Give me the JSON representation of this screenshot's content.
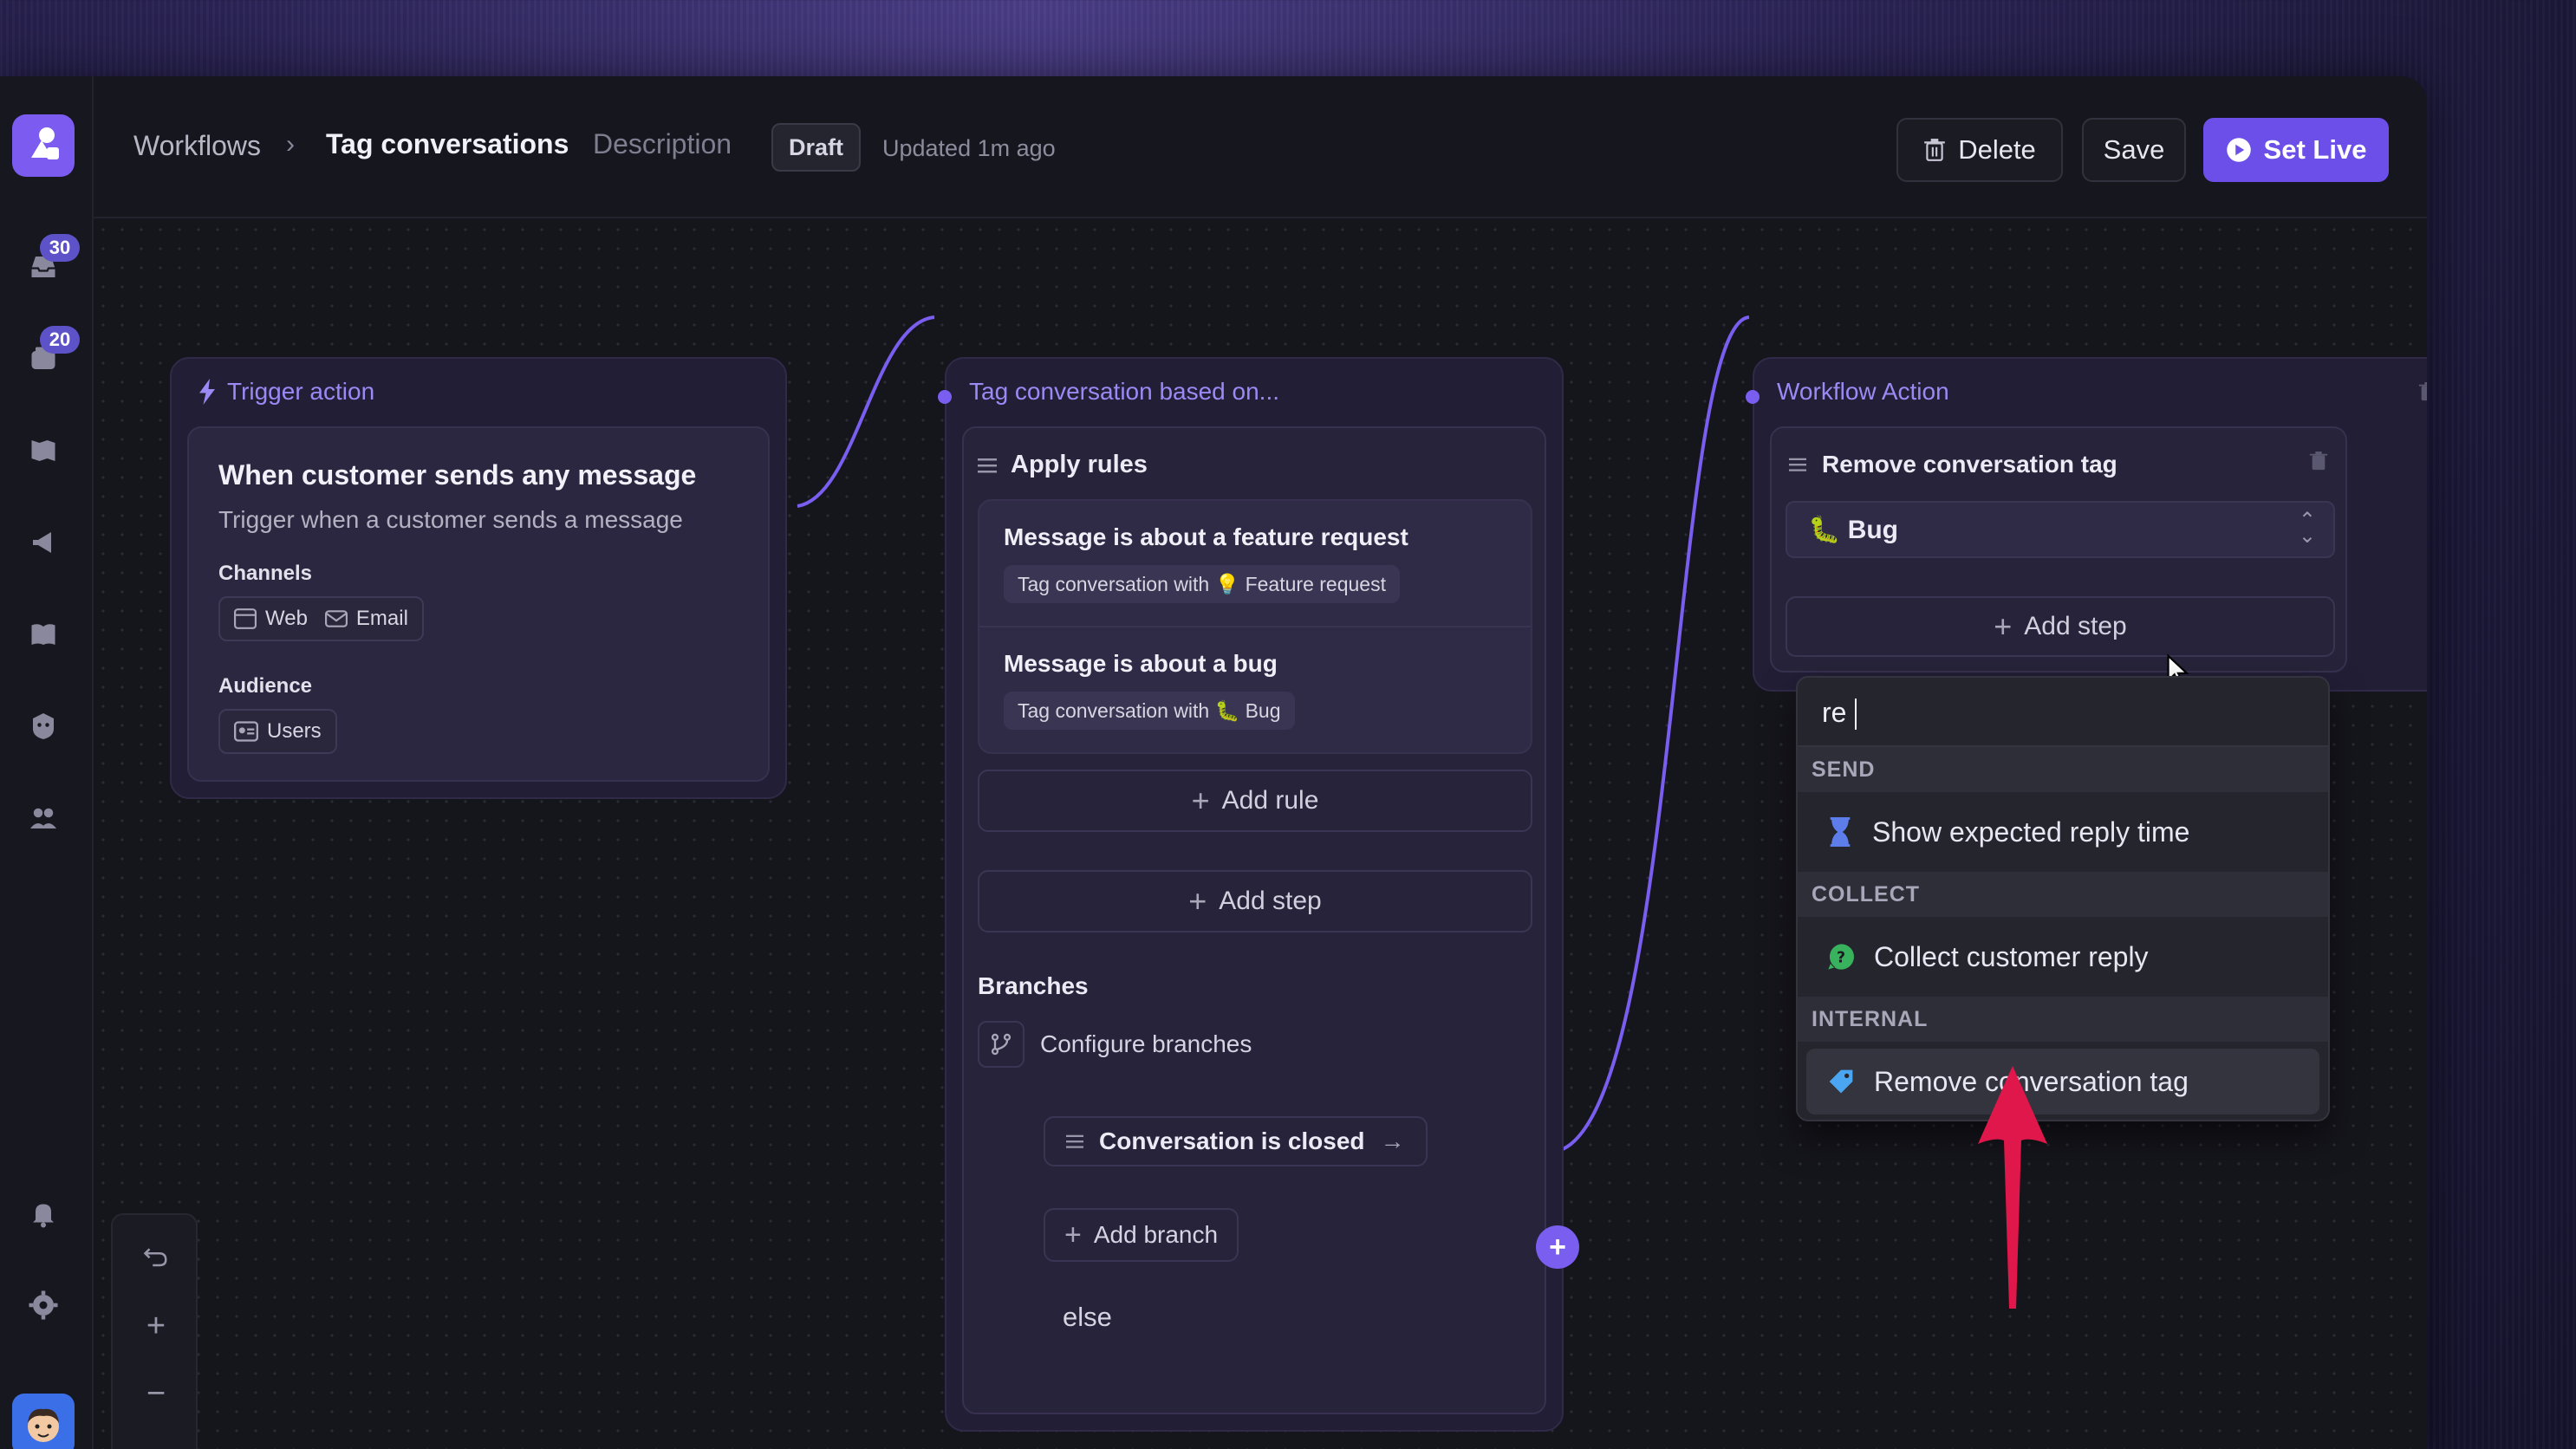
{
  "header": {
    "breadcrumb_root": "Workflows",
    "breadcrumb_current": "Tag conversations",
    "description_link": "Description",
    "status_badge": "Draft",
    "updated_text": "Updated 1m ago",
    "delete_label": "Delete",
    "save_label": "Save",
    "set_live_label": "Set Live"
  },
  "sidebar": {
    "inbox_badge": "30",
    "tickets_badge": "20"
  },
  "trigger_node": {
    "header": "Trigger action",
    "title": "When customer sends any message",
    "subtitle": "Trigger when a customer sends a message",
    "channels_label": "Channels",
    "channels": [
      "Web",
      "Email"
    ],
    "audience_label": "Audience",
    "audience": "Users"
  },
  "rules_node": {
    "header": "Tag conversation based on...",
    "apply_rules_label": "Apply rules",
    "rules": [
      {
        "title": "Message is about a feature request",
        "action": "Tag conversation with 💡 Feature request"
      },
      {
        "title": "Message is about a bug",
        "action": "Tag conversation with 🐛 Bug"
      }
    ],
    "add_rule_label": "Add rule",
    "add_step_label": "Add step",
    "branches_label": "Branches",
    "configure_branches_label": "Configure branches",
    "branch_label": "Conversation is closed",
    "add_branch_label": "Add branch",
    "else_label": "else"
  },
  "action_node": {
    "header": "Workflow Action",
    "step_title": "Remove conversation tag",
    "tag_select_value": "🐛 Bug",
    "add_step_label": "Add step"
  },
  "dropdown": {
    "search_value": "re",
    "sections": [
      {
        "label": "SEND",
        "item": "Show expected reply time"
      },
      {
        "label": "COLLECT",
        "item": "Collect customer reply"
      },
      {
        "label": "INTERNAL",
        "item": "Remove conversation tag"
      }
    ]
  },
  "colors": {
    "accent": "#6c4fe8",
    "node_header": "#9b8af4",
    "annotation_arrow": "#e0174a"
  }
}
